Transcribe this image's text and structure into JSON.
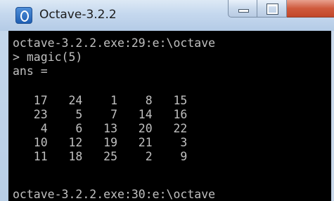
{
  "window": {
    "title": "Octave-3.2.2"
  },
  "console": {
    "prompt1": "octave-3.2.2.exe:29:e:\\octave",
    "command": "> magic(5)",
    "result_label": "ans =",
    "matrix_rows": [
      "   17   24    1    8   15",
      "   23    5    7   14   16",
      "    4    6   13   20   22",
      "   10   12   19   21    3",
      "   11   18   25    2    9"
    ],
    "prompt2": "octave-3.2.2.exe:30:e:\\octave"
  },
  "colors": {
    "console_background": "#000000",
    "console_text": "#c0c0c0",
    "close_button": "#c2472a",
    "titlebar": "#c5d8ee"
  },
  "icons": {
    "app": "octave-app-icon",
    "minimize": "minimize-icon",
    "maximize": "maximize-icon",
    "close": "close-icon"
  }
}
